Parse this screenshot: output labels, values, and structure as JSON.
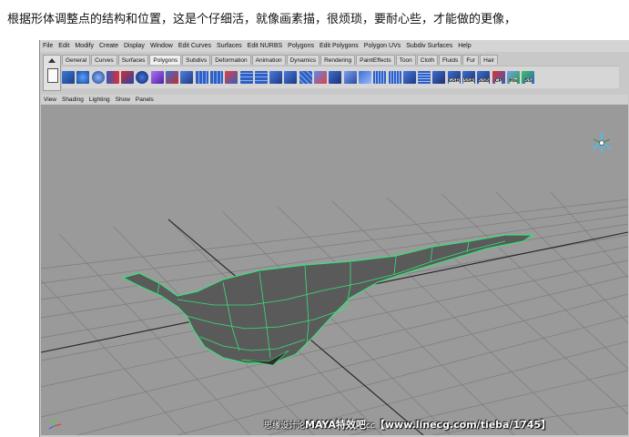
{
  "caption": "根据形体调整点的结构和位置，这是个仔细活，就像画素描，很烦琐，要耐心些，才能做的更像，",
  "menubar": [
    "File",
    "Edit",
    "Modify",
    "Create",
    "Display",
    "Window",
    "Edit Curves",
    "Surfaces",
    "Edit NURBS",
    "Polygons",
    "Edit Polygons",
    "Polygon UVs",
    "Subdiv Surfaces",
    "Help"
  ],
  "shelf_tabs": [
    "General",
    "Curves",
    "Surfaces",
    "Polygons",
    "Subdivs",
    "Deformation",
    "Animation",
    "Dynamics",
    "Rendering",
    "PaintEffects",
    "Toon",
    "Cloth",
    "Fluids",
    "Fur",
    "Hair"
  ],
  "active_tab": "Polygons",
  "shelf_icon_labels": [
    "GSR",
    "SSR",
    "SSB",
    "CP",
    "His",
    "SS"
  ],
  "panel_menu": [
    "View",
    "Shading",
    "Lighting",
    "Show",
    "Panels"
  ],
  "watermark": {
    "prefix": "思缘设计论",
    "middle": "MAYA特效吧",
    "suffix": "cc",
    "url": "【www.linecg.com/tieba/1745】"
  },
  "colors": {
    "viewport_bg": "#9a9a9a",
    "grid": "#7a7a7a",
    "model_fill": "#5a5a5a",
    "wireframe": "#39e07a"
  }
}
